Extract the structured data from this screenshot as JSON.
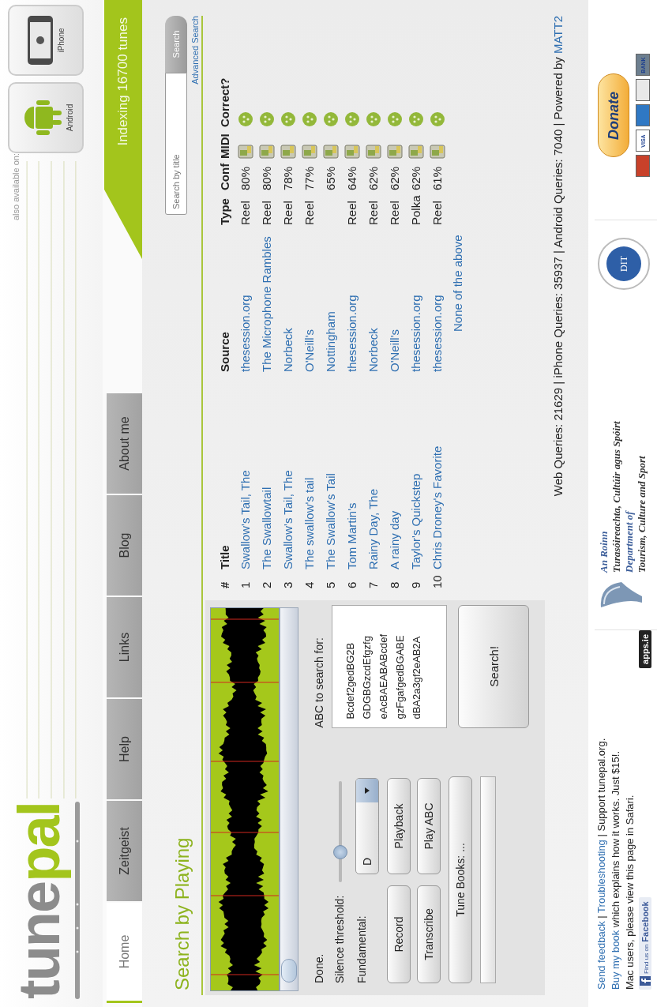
{
  "header": {
    "logo": {
      "part_1": "tune",
      "part_2": "pal"
    },
    "also_available": "also available on:",
    "apps": [
      {
        "kind": "android",
        "label": "Android"
      },
      {
        "kind": "iphone",
        "label": "iPhone"
      }
    ]
  },
  "nav": {
    "tabs": [
      {
        "label": "Home",
        "selected": true
      },
      {
        "label": "Zeitgeist",
        "selected": false
      },
      {
        "label": "Help",
        "selected": false
      },
      {
        "label": "Links",
        "selected": false
      },
      {
        "label": "Blog",
        "selected": false
      },
      {
        "label": "About me",
        "selected": false
      }
    ],
    "banner": "Indexing 16700 tunes"
  },
  "heading": "Search by Playing",
  "search": {
    "placeholder": "Search by title",
    "button": "Search",
    "advanced": "Advanced Search"
  },
  "recorder": {
    "status": "Done.",
    "silence_label": "Silence threshold:",
    "silence": {
      "level": 0.3
    },
    "fundamental_label": "Fundamental:",
    "fundamental": "D",
    "buttons": [
      "Record",
      "Playback",
      "Transcribe",
      "Play ABC"
    ],
    "tune_books": "Tune Books: ...",
    "progress": {
      "level": 0
    },
    "abc_label": "ABC to search for:",
    "abc_lines": [
      "Bcdef2gedBG2B",
      "GDGBGzcdEfgzfg",
      "eAcBAEABABcdef",
      "gzFgafgedBGABE",
      "dBA2a3gf2eAB2A"
    ],
    "search_button": "Search!"
  },
  "table": {
    "columns": [
      "#",
      "Title",
      "Source",
      "Type",
      "Conf",
      "MIDI",
      "Correct?"
    ],
    "rows": [
      {
        "number": "1",
        "title": "Swallow's Tail, The",
        "source": "thesession.org",
        "type": "Reel",
        "conf": "80%"
      },
      {
        "number": "2",
        "title": "The Swallowtail",
        "source": "The Microphone Rambles",
        "type": "Reel",
        "conf": "80%"
      },
      {
        "number": "3",
        "title": "Swallow's Tail, The",
        "source": "Norbeck",
        "type": "Reel",
        "conf": "78%"
      },
      {
        "number": "4",
        "title": "The swallow's tail",
        "source": "O'Neill's",
        "type": "Reel",
        "conf": "77%"
      },
      {
        "number": "5",
        "title": "The Swallow's Tail",
        "source": "Nottingham",
        "conf": "65%"
      },
      {
        "number": "6",
        "title": "Tom Martin's",
        "source": "thesession.org",
        "type": "Reel",
        "conf": "64%"
      },
      {
        "number": "7",
        "title": "Rainy Day, The",
        "source": "Norbeck",
        "type": "Reel",
        "conf": "62%"
      },
      {
        "number": "8",
        "title": "A rainy day",
        "source": "O'Neill's",
        "type": "Reel",
        "conf": "62%"
      },
      {
        "number": "9",
        "title": "Taylor's Quickstep",
        "source": "thesession.org",
        "type": "Polka",
        "conf": "62%"
      },
      {
        "number": "10",
        "title": "Chris Droney's Favorite",
        "source": "thesession.org",
        "type": "Reel",
        "conf": "61%"
      }
    ],
    "none_link": "None of the above"
  },
  "stats": {
    "text": "Web Queries: 21629 | iPhone Queries: 35937 | Android Queries: 7040 | Powered by ",
    "link": "MATT2"
  },
  "footer": {
    "lines": [
      [
        {
          "text": "Send feedback",
          "link": true
        },
        {
          "text": " | ",
          "link": false
        },
        {
          "text": "Troubleshooting",
          "link": true
        },
        {
          "text": " | Support tunepal.org.",
          "link": false
        }
      ],
      [
        {
          "text": "Buy my book",
          "link": true
        },
        {
          "text": " which explains how it works. Just $15!.",
          "link": false
        }
      ]
    ],
    "note": "Mac users, please view this page in Safari.",
    "badges": [
      {
        "kind": "facebook",
        "small": "Find us on",
        "label": "Facebook"
      },
      {
        "kind": "apps",
        "label": "apps.ie"
      }
    ],
    "sponsor": [
      {
        "text": "An Roinn",
        "kind": "blue"
      },
      {
        "text": "Turasóireachta, Cultúir agus Spóirt",
        "kind": "dark"
      },
      {
        "text": "Department of",
        "kind": "blue"
      },
      {
        "text": "Tourism, Culture and Sport",
        "kind": "dark"
      }
    ],
    "seal": "DIT",
    "donate": "Donate",
    "cards": [
      {
        "kind": "mastercard"
      },
      {
        "kind": "visa",
        "label": "VISA"
      },
      {
        "kind": "amex"
      },
      {
        "kind": "maestro"
      },
      {
        "kind": "bank",
        "label": "BANK"
      }
    ]
  }
}
